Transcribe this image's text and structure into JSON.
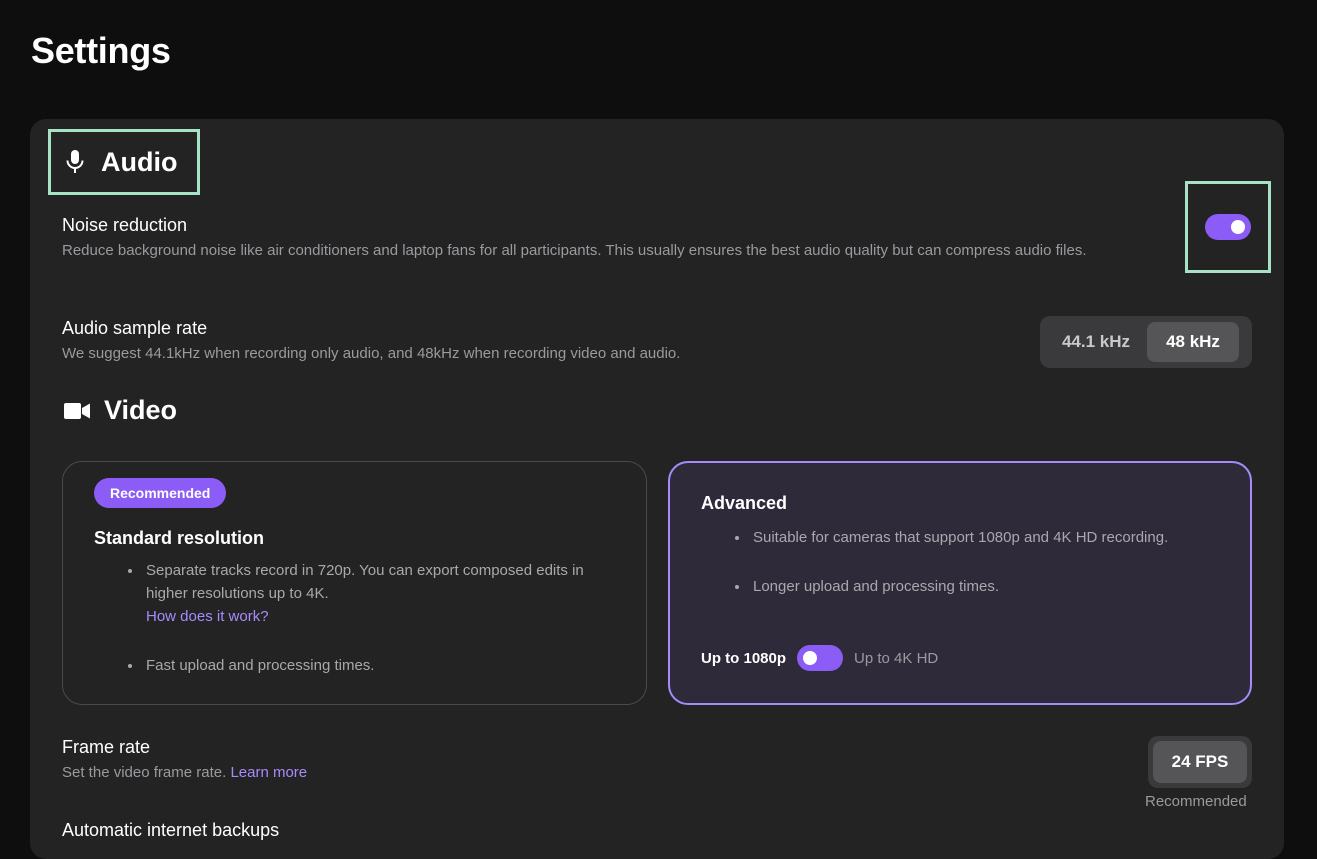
{
  "page": {
    "title": "Settings"
  },
  "audio": {
    "heading": "Audio",
    "icon": "microphone-icon",
    "noise_reduction": {
      "title": "Noise reduction",
      "description": "Reduce background noise like air conditioners and laptop fans for all participants. This usually ensures the best audio quality but can compress audio files.",
      "enabled": true
    },
    "sample_rate": {
      "title": "Audio sample rate",
      "description": "We suggest 44.1kHz when recording only audio, and 48kHz when recording video and audio.",
      "options": [
        "44.1 kHz",
        "48 kHz"
      ],
      "selected": "48 kHz"
    }
  },
  "video": {
    "heading": "Video",
    "icon": "video-camera-icon",
    "standard": {
      "badge": "Recommended",
      "title": "Standard resolution",
      "bullet1": "Separate tracks record in 720p. You can export composed edits in higher resolutions up to 4K.",
      "link": "How does it work?",
      "bullet2": "Fast upload and processing times."
    },
    "advanced": {
      "title": "Advanced",
      "bullet1": "Suitable for cameras that support 1080p and 4K HD recording.",
      "bullet2": "Longer upload and processing times.",
      "toggle_left_label": "Up to 1080p",
      "toggle_right_label": "Up to 4K HD",
      "toggle_on": false
    }
  },
  "frame_rate": {
    "title": "Frame rate",
    "description": "Set the video frame rate.",
    "link": "Learn more",
    "value": "24 FPS",
    "note": "Recommended"
  },
  "backups": {
    "title": "Automatic internet backups"
  },
  "colors": {
    "accent": "#8b5cf6",
    "highlight": "#a7e2c6",
    "card": "#232324",
    "background": "#0e0e0f"
  }
}
